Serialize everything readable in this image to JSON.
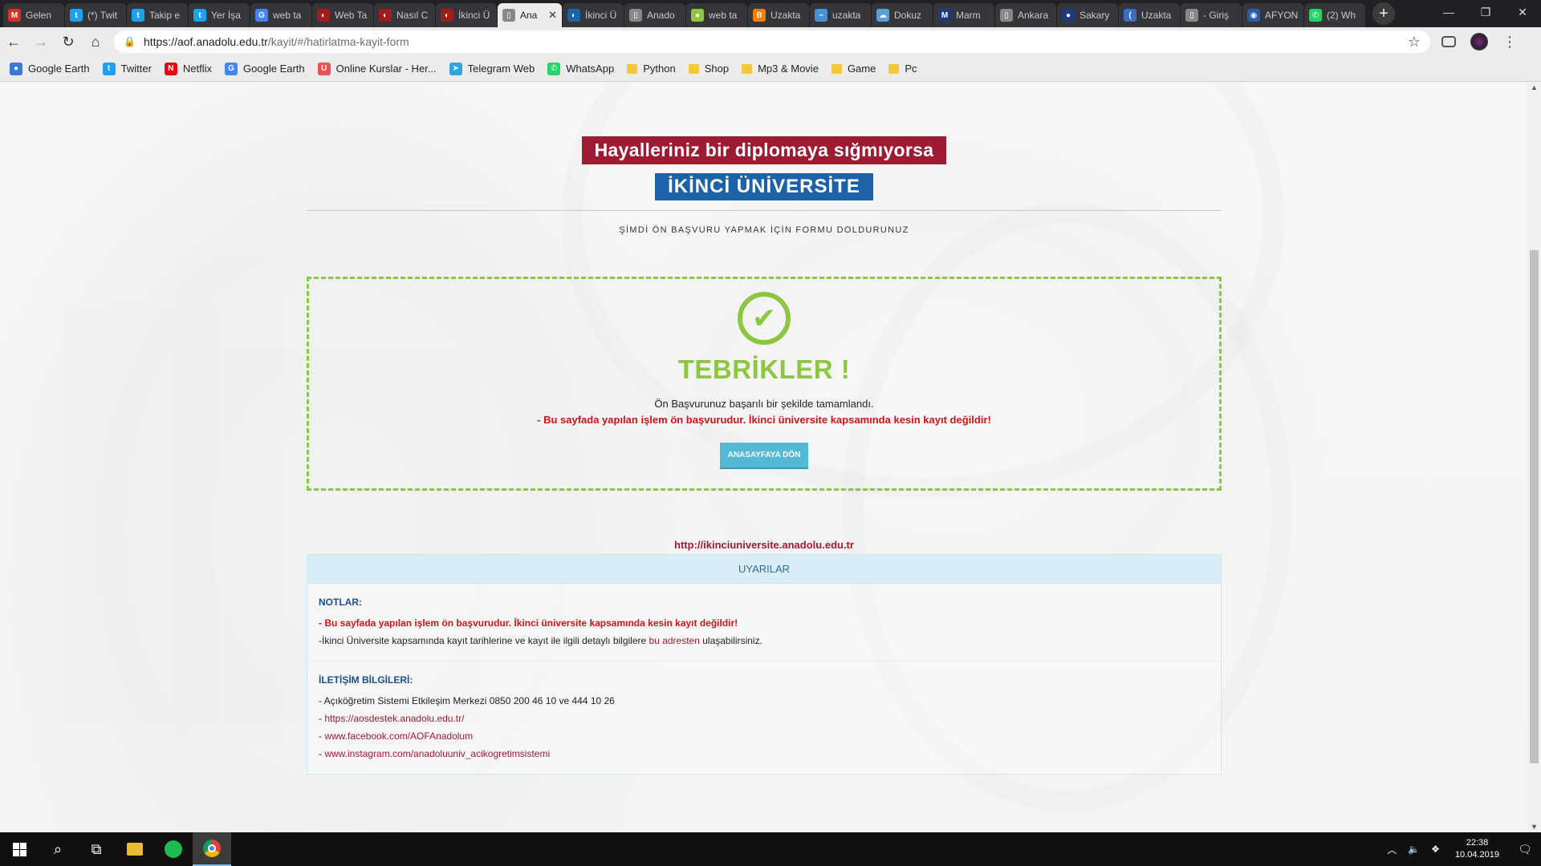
{
  "browser": {
    "tabs": [
      {
        "title": "Gelen",
        "icon": "gmail-icon",
        "color": "#d93025",
        "glyph": "M"
      },
      {
        "title": "(*) Twit",
        "icon": "twitter-icon",
        "color": "#1da1f2",
        "glyph": "t"
      },
      {
        "title": "Takip e",
        "icon": "twitter-icon",
        "color": "#1da1f2",
        "glyph": "t"
      },
      {
        "title": "Yer İşa",
        "icon": "twitter-icon",
        "color": "#1da1f2",
        "glyph": "t"
      },
      {
        "title": "web ta",
        "icon": "google-icon",
        "color": "#4285f4",
        "glyph": "G"
      },
      {
        "title": "Web Ta",
        "icon": "udemy-icon",
        "color": "#a01b1b",
        "glyph": "◐"
      },
      {
        "title": "Nasıl C",
        "icon": "udemy-icon",
        "color": "#a01b1b",
        "glyph": "◐"
      },
      {
        "title": "İkinci Ü",
        "icon": "udemy-icon",
        "color": "#a01b1b",
        "glyph": "◐"
      },
      {
        "title": "Ana",
        "icon": "page-icon",
        "color": "#888888",
        "glyph": "▯",
        "active": true
      },
      {
        "title": "İkinci Ü",
        "icon": "anadolu-icon",
        "color": "#1b62a8",
        "glyph": "◐"
      },
      {
        "title": "Anado",
        "icon": "page-icon",
        "color": "#888888",
        "glyph": "▯"
      },
      {
        "title": "web ta",
        "icon": "android-icon",
        "color": "#8dc63f",
        "glyph": "●"
      },
      {
        "title": "Uzakta",
        "icon": "blogger-icon",
        "color": "#f57d00",
        "glyph": "B"
      },
      {
        "title": "uzakta",
        "icon": "swoosh-icon",
        "color": "#4a90d9",
        "glyph": "~"
      },
      {
        "title": "Dokuz",
        "icon": "cloud-icon",
        "color": "#5a9fd4",
        "glyph": "☁"
      },
      {
        "title": "Marm",
        "icon": "marmara-icon",
        "color": "#1b3a7a",
        "glyph": "M"
      },
      {
        "title": "Ankara",
        "icon": "page-icon",
        "color": "#888888",
        "glyph": "▯"
      },
      {
        "title": "Sakary",
        "icon": "sakarya-icon",
        "color": "#1b3a7a",
        "glyph": "●"
      },
      {
        "title": "Uzakta",
        "icon": "swoosh-icon",
        "color": "#3b6fc4",
        "glyph": "("
      },
      {
        "title": "- Giriş",
        "icon": "page-icon",
        "color": "#888888",
        "glyph": "▯"
      },
      {
        "title": "AFYON",
        "icon": "afyon-icon",
        "color": "#2a5aa8",
        "glyph": "◉"
      },
      {
        "title": "(2) Wh",
        "icon": "whatsapp-icon",
        "color": "#25d366",
        "glyph": "✆"
      }
    ],
    "url_host": "https://aof.anadolu.edu.tr",
    "url_path": "/kayit/#/hatirlatma-kayit-form",
    "bookmarks": [
      {
        "label": "Google Earth",
        "icon": "google-earth-icon",
        "color": "#3b78d8",
        "glyph": "●"
      },
      {
        "label": "Twitter",
        "icon": "twitter-icon",
        "color": "#1da1f2",
        "glyph": "t"
      },
      {
        "label": "Netflix",
        "icon": "netflix-icon",
        "color": "#e50914",
        "glyph": "N"
      },
      {
        "label": "Google Earth",
        "icon": "google-icon",
        "color": "#4285f4",
        "glyph": "G"
      },
      {
        "label": "Online Kurslar - Her...",
        "icon": "udemy-icon",
        "color": "#ec5252",
        "glyph": "U"
      },
      {
        "label": "Telegram Web",
        "icon": "telegram-icon",
        "color": "#2ca5e0",
        "glyph": "➤"
      },
      {
        "label": "WhatsApp",
        "icon": "whatsapp-icon",
        "color": "#25d366",
        "glyph": "✆"
      },
      {
        "label": "Python",
        "icon": "folder-icon",
        "folder": true
      },
      {
        "label": "Shop",
        "icon": "folder-icon",
        "folder": true
      },
      {
        "label": "Mp3 & Movie",
        "icon": "folder-icon",
        "folder": true
      },
      {
        "label": "Game",
        "icon": "folder-icon",
        "folder": true
      },
      {
        "label": "Pc",
        "icon": "folder-icon",
        "folder": true
      }
    ]
  },
  "page": {
    "hero_line1": "Hayalleriniz bir diplomaya sığmıyorsa",
    "hero_line2": "İKİNCİ ÜNİVERSİTE",
    "subtitle": "ŞİMDİ ÖN BAŞVURU YAPMAK İÇİN FORMU DOLDURUNUZ",
    "success": {
      "title": "TEBRİKLER !",
      "message": "Ön Başvurunuz başarılı bir şekilde tamamlandı.",
      "warning": "- Bu sayfada yapılan işlem ön başvurudur. İkinci üniversite kapsamında kesin kayıt değildir!",
      "button": "ANASAYFAYA DÖN"
    },
    "site_link": "http://ikinciuniversite.anadolu.edu.tr",
    "warnings_header": "UYARILAR",
    "notes_title": "NOTLAR:",
    "notes_red": "- Bu sayfada yapılan işlem ön başvurudur. İkinci üniversite kapsamında kesin kayıt değildir!",
    "notes_text_before": "-İkinci Üniversite kapsamında kayıt tarihlerine ve kayıt ile ilgili detaylı bilgilere ",
    "notes_link": "bu adresten",
    "notes_text_after": " ulaşabilirsiniz.",
    "contact_title": "İLETİŞİM BİLGİLERİ:",
    "contact_phone": "- Açıköğretim Sistemi Etkileşim Merkezi 0850 200 46 10 ve 444 10 26",
    "contact_links": [
      "https://aosdestek.anadolu.edu.tr/",
      "www.facebook.com/AOFAnadolum",
      "www.instagram.com/anadoluuniv_acikogretimsistemi"
    ],
    "colors": {
      "brand_red": "#9e1b32",
      "brand_blue": "#1b62a8",
      "success_green": "#8dc63f",
      "button_blue": "#54b8d7"
    }
  },
  "taskbar": {
    "time": "22:38",
    "date": "10.04.2019"
  }
}
